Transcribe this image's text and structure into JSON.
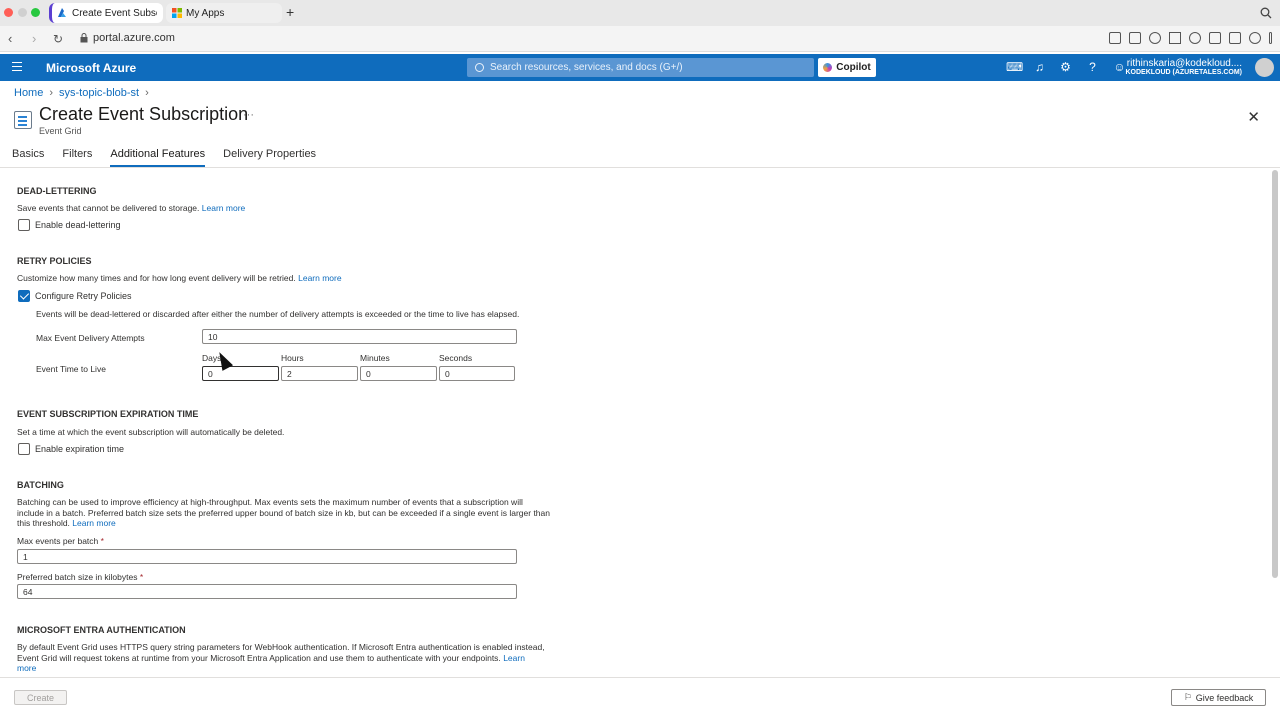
{
  "browser": {
    "tabs": [
      {
        "label": "Create Event Subscripti",
        "active": true
      },
      {
        "label": "My Apps",
        "active": false
      }
    ],
    "url": "portal.azure.com"
  },
  "header": {
    "brand": "Microsoft Azure",
    "search_placeholder": "Search resources, services, and docs (G+/)",
    "copilot_label": "Copilot",
    "user_email": "rithinskaria@kodekloud....",
    "user_tenant": "KODEKLOUD (AZURETALES.COM)",
    "accent_color": "#0f6cbd"
  },
  "breadcrumb": {
    "items": [
      "Home",
      "sys-topic-blob-st"
    ]
  },
  "page": {
    "title": "Create Event Subscription",
    "subtitle": "Event Grid",
    "ellipsis": "···",
    "close": "✕"
  },
  "tabs": [
    "Basics",
    "Filters",
    "Additional Features",
    "Delivery Properties"
  ],
  "active_tab": "Additional Features",
  "dead_lettering": {
    "heading": "DEAD-LETTERING",
    "desc": "Save events that cannot be delivered to storage.",
    "learn_more": "Learn more",
    "checkbox_label": "Enable dead-lettering",
    "checked": false
  },
  "retry": {
    "heading": "RETRY POLICIES",
    "desc": "Customize how many times and for how long event delivery will be retried.",
    "learn_more": "Learn more",
    "checkbox_label": "Configure Retry Policies",
    "checked": true,
    "note": "Events will be dead-lettered or discarded after either the number of delivery attempts is exceeded or the time to live has elapsed.",
    "max_attempts_label": "Max Event Delivery Attempts",
    "max_attempts_value": "10",
    "ttl_label": "Event Time to Live",
    "ttl_days_label": "Days",
    "ttl_hours_label": "Hours",
    "ttl_minutes_label": "Minutes",
    "ttl_seconds_label": "Seconds",
    "ttl_days": "0",
    "ttl_hours": "2",
    "ttl_minutes": "0",
    "ttl_seconds": "0"
  },
  "expiration": {
    "heading": "EVENT SUBSCRIPTION EXPIRATION TIME",
    "desc": "Set a time at which the event subscription will automatically be deleted.",
    "checkbox_label": "Enable expiration time",
    "checked": false
  },
  "batching": {
    "heading": "BATCHING",
    "desc_1": "Batching can be used to improve efficiency at high-throughput. Max events sets the maximum number of events that a subscription will",
    "desc_2": "include in a batch. Preferred batch size sets the preferred upper bound of batch size in kb, but can be exceeded if a single event is larger than",
    "desc_3": "this threshold.",
    "learn_more": "Learn more",
    "max_events_label": "Max events per batch",
    "max_events_value": "1",
    "batch_size_label": "Preferred batch size in kilobytes",
    "batch_size_value": "64",
    "required_mark": "*"
  },
  "entra": {
    "heading": "MICROSOFT ENTRA AUTHENTICATION",
    "desc_1": "By default Event Grid uses HTTPS query string parameters for WebHook authentication. If Microsoft Entra authentication is enabled instead,",
    "desc_2": "Event Grid will request tokens at runtime from your Microsoft Entra Application and use them to authenticate with your endpoints.",
    "learn_more_1": "Learn",
    "learn_more_2": "more"
  },
  "footer": {
    "create_label": "Create",
    "feedback_label": "Give feedback"
  }
}
